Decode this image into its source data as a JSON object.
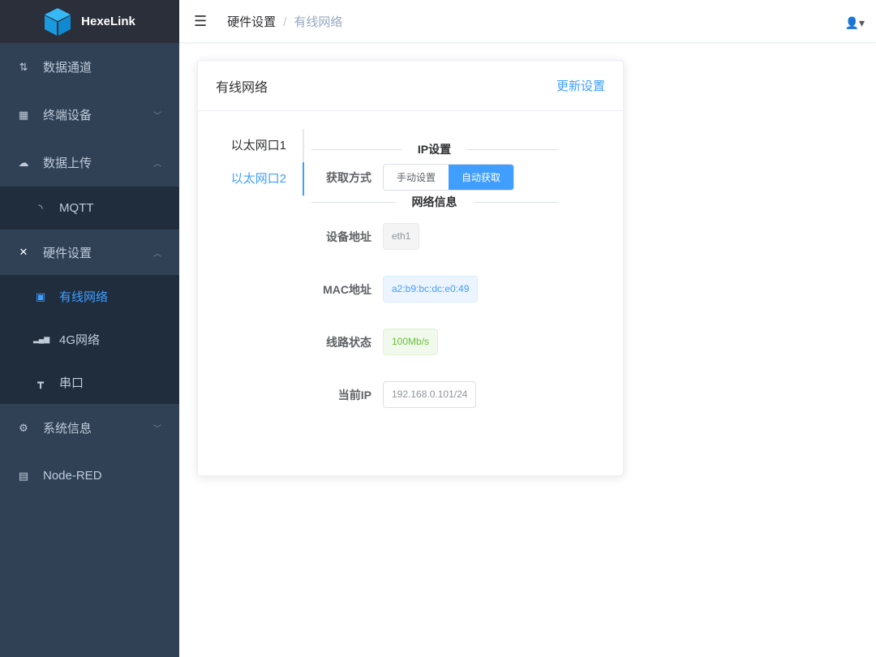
{
  "app": {
    "name": "HexeLink"
  },
  "sidebar": {
    "items": [
      {
        "label": "数据通道",
        "icon": "data-channel-icon"
      },
      {
        "label": "终端设备",
        "icon": "device-icon"
      },
      {
        "label": "数据上传",
        "icon": "cloud-upload-icon"
      },
      {
        "label": "MQTT",
        "icon": "rss-icon"
      },
      {
        "label": "硬件设置",
        "icon": "tools-icon"
      },
      {
        "label": "有线网络",
        "icon": "ethernet-icon"
      },
      {
        "label": "4G网络",
        "icon": "signal-icon"
      },
      {
        "label": "串口",
        "icon": "serial-icon"
      },
      {
        "label": "系统信息",
        "icon": "gear-icon"
      },
      {
        "label": "Node-RED",
        "icon": "node-red-icon"
      }
    ]
  },
  "breadcrumb": {
    "parent": "硬件设置",
    "sep": "/",
    "current": "有线网络"
  },
  "card": {
    "title": "有线网络",
    "update_label": "更新设置",
    "tabs": [
      "以太网口1",
      "以太网口2"
    ],
    "ip_section": "IP设置",
    "mode_label": "获取方式",
    "modes": [
      "手动设置",
      "自动获取"
    ],
    "net_section": "网络信息",
    "device_label": "设备地址",
    "device": "eth1",
    "mac_label": "MAC地址",
    "mac": "a2:b9:bc:dc:e0:49",
    "link_label": "线路状态",
    "link": "100Mb/s",
    "ip_label": "当前IP",
    "ip": "192.168.0.101/24"
  },
  "colors": {
    "accent": "#409eff",
    "sidebar": "#304156"
  }
}
